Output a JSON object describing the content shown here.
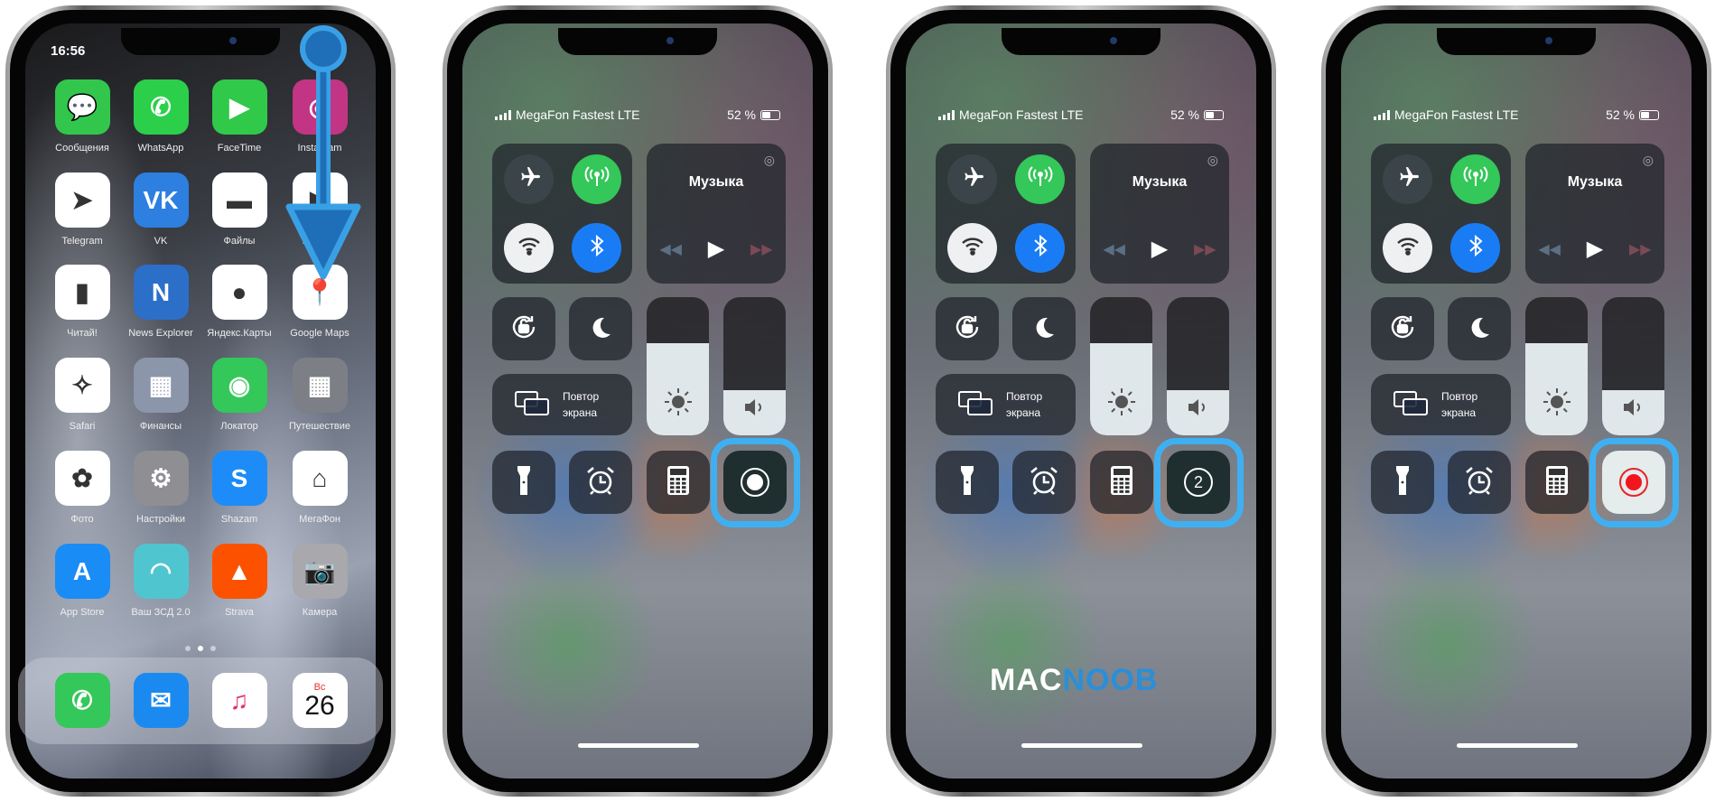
{
  "home_screen": {
    "time": "16:56",
    "apps": [
      {
        "label": "Сообщения",
        "icon": "messages-icon",
        "color": "#32c74c",
        "glyph": "💬"
      },
      {
        "label": "WhatsApp",
        "icon": "whatsapp-icon",
        "color": "#2ccf4a",
        "glyph": "✆"
      },
      {
        "label": "FaceTime",
        "icon": "facetime-icon",
        "color": "#30c94a",
        "glyph": "▶"
      },
      {
        "label": "Instagram",
        "icon": "instagram-icon",
        "color": "#c13584",
        "glyph": "◎"
      },
      {
        "label": "Telegram",
        "icon": "telegram-icon",
        "color": "#ffffff",
        "glyph": "➤"
      },
      {
        "label": "VK",
        "icon": "vk-icon",
        "color": "#2d7fe0",
        "glyph": "VK"
      },
      {
        "label": "Файлы",
        "icon": "files-icon",
        "color": "#ffffff",
        "glyph": "▬"
      },
      {
        "label": "YouTube",
        "icon": "youtube-icon",
        "color": "#ffffff",
        "glyph": "▶"
      },
      {
        "label": "Читай!",
        "icon": "litres-icon",
        "color": "#ffffff",
        "glyph": "▮"
      },
      {
        "label": "News Explorer",
        "icon": "news-explorer-icon",
        "color": "#2b6fc9",
        "glyph": "N"
      },
      {
        "label": "Яндекс.Карты",
        "icon": "yandex-maps-icon",
        "color": "#ffffff",
        "glyph": "●"
      },
      {
        "label": "Google Maps",
        "icon": "google-maps-icon",
        "color": "#ffffff",
        "glyph": "📍"
      },
      {
        "label": "Safari",
        "icon": "safari-icon",
        "color": "#ffffff",
        "glyph": "✧"
      },
      {
        "label": "Финансы",
        "icon": "folder-icon",
        "color": "#8c96aa",
        "glyph": "▦"
      },
      {
        "label": "Локатор",
        "icon": "find-my-icon",
        "color": "#34c759",
        "glyph": "◉"
      },
      {
        "label": "Путешествие",
        "icon": "folder-icon",
        "color": "#7c7f86",
        "glyph": "▦"
      },
      {
        "label": "Фото",
        "icon": "photos-icon",
        "color": "#ffffff",
        "glyph": "✿"
      },
      {
        "label": "Настройки",
        "icon": "settings-icon",
        "color": "#8e8e93",
        "glyph": "⚙"
      },
      {
        "label": "Shazam",
        "icon": "shazam-icon",
        "color": "#1d8cf8",
        "glyph": "S"
      },
      {
        "label": "МегаФон",
        "icon": "megafon-icon",
        "color": "#ffffff",
        "glyph": "⌂"
      },
      {
        "label": "App Store",
        "icon": "app-store-icon",
        "color": "#1a8cf5",
        "glyph": "A"
      },
      {
        "label": "Ваш ЗСД 2.0",
        "icon": "zsd-icon",
        "color": "#4fc6cf",
        "glyph": "◠"
      },
      {
        "label": "Strava",
        "icon": "strava-icon",
        "color": "#fc5200",
        "glyph": "▲"
      },
      {
        "label": "Камера",
        "icon": "camera-icon",
        "color": "#a8a8ad",
        "glyph": "📷"
      }
    ],
    "dock": [
      {
        "icon": "phone-icon",
        "color": "#34c759",
        "glyph": "✆"
      },
      {
        "icon": "mail-icon",
        "color": "#1b8af0",
        "glyph": "✉"
      },
      {
        "icon": "music-icon",
        "color": "#ffffff",
        "glyph": "♫"
      },
      {
        "icon": "calendar-icon",
        "color": "#ffffff",
        "weekday": "Вс",
        "day": "26"
      }
    ],
    "page_count": 3,
    "current_page": 2,
    "swipe_arrow_color": "#3aa0e6"
  },
  "control_center": {
    "carrier": "MegaFon Fastest LTE",
    "battery": "52 %",
    "music_title": "Музыка",
    "mirroring_line1": "Повтор",
    "mirroring_line2": "экрана",
    "brightness_level": 0.67,
    "volume_level": 0.33,
    "toggles": {
      "airplane": false,
      "cellular": true,
      "wifi": true,
      "bluetooth": true
    },
    "highlight_color": "#3eb0f2",
    "states": [
      {
        "record_state": "idle"
      },
      {
        "record_state": "countdown",
        "countdown": "2"
      },
      {
        "record_state": "recording"
      }
    ]
  },
  "watermark": {
    "part1": "MAC",
    "part2": "NOOB"
  }
}
